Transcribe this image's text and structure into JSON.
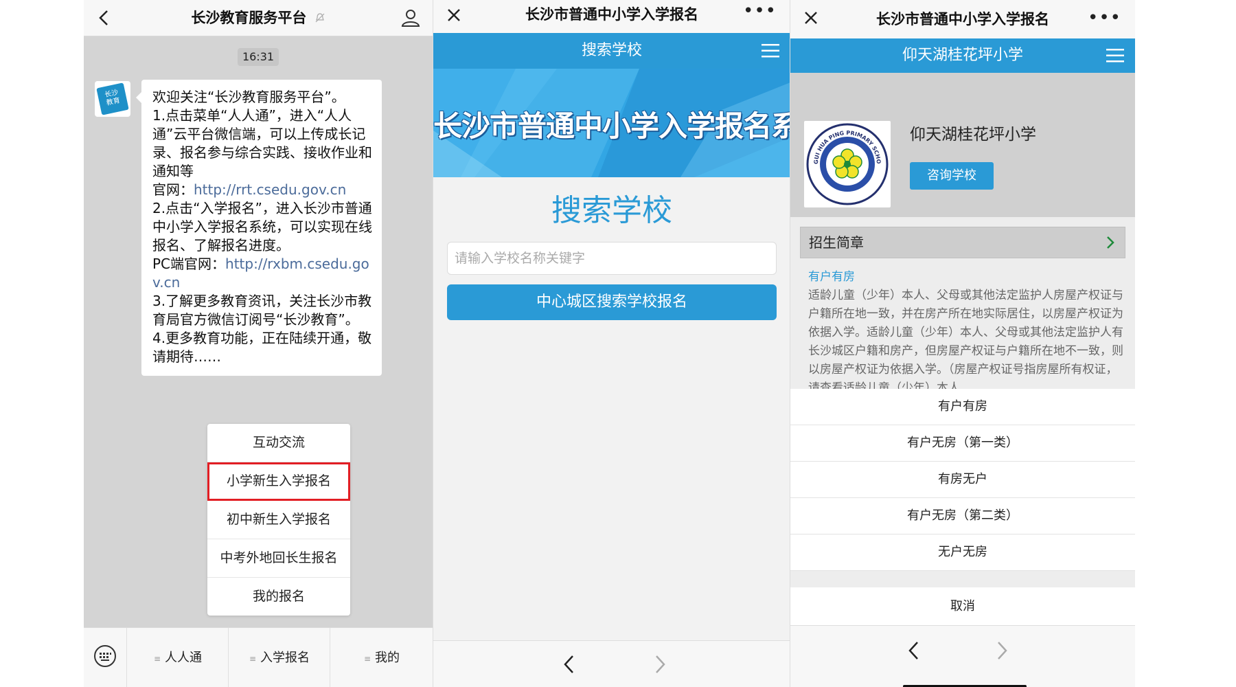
{
  "screen1": {
    "title": "长沙教育服务平台",
    "time": "16:31",
    "avatar_text": "长沙\n教育",
    "message": {
      "line1": "欢迎关注“长沙教育服务平台”。",
      "p1": "1.点击菜单“人人通”，进入“人人通”云平台微信端，可以上传成长记录、报名参与综合实践、接收作业和通知等",
      "site1_label": "官网：",
      "site1_url": "http://rrt.csedu.gov.cn",
      "p2": "2.点击“入学报名”，进入长沙市普通中小学入学报名系统，可以实现在线报名、了解报名进度。",
      "site2_label": "PC端官网：",
      "site2_url": "http://rxbm.csedu.gov.cn",
      "p3": "3.了解更多教育资讯，关注长沙市教育局官方微信订阅号“长沙教育”。",
      "p4": "4.更多教育功能，正在陆续开通，敬请期待……"
    },
    "popup_menu": [
      "互动交流",
      "小学新生入学报名",
      "初中新生入学报名",
      "中考外地回长生报名",
      "我的报名"
    ],
    "bottom_menu": [
      "人人通",
      "入学报名",
      "我的"
    ]
  },
  "screen2": {
    "title": "长沙市普通中小学入学报名",
    "header": "搜索学校",
    "banner": "长沙市普通中小学入学报名系统",
    "heading": "搜索学校",
    "search_placeholder": "请输入学校名称关键字",
    "search_button": "中心城区搜索学校报名"
  },
  "screen3": {
    "title": "长沙市普通中小学入学报名",
    "header": "仰天湖桂花坪小学",
    "school_name": "仰天湖桂花坪小学",
    "logo_text": "GUI HUA PING PRIMARY SCHOOL",
    "consult_button": "咨询学校",
    "section_title": "招生简章",
    "intro_heading": "有户有房",
    "intro_text": "适龄儿童（少年）本人、父母或其他法定监护人房屋产权证与户籍所在地一致，并在房产所在地实际居住，以房屋产权证为依据入学。适龄儿童（少年）本人、父母或其他法定监护人有长沙城区户籍和房产，但房屋产权证与户籍所在地不一致，则以房屋产权证为依据入学。（房屋产权证号指房屋所有权证，请查看适龄儿童（少年）本人",
    "sheet_options": [
      "有户有房",
      "有户无房（第一类）",
      "有房无户",
      "有户无房（第二类）",
      "无户无房"
    ],
    "cancel": "取消"
  },
  "colors": {
    "accent_blue": "#2a9ad6",
    "highlight_red": "#e21e24",
    "link": "#4b6b9a"
  }
}
